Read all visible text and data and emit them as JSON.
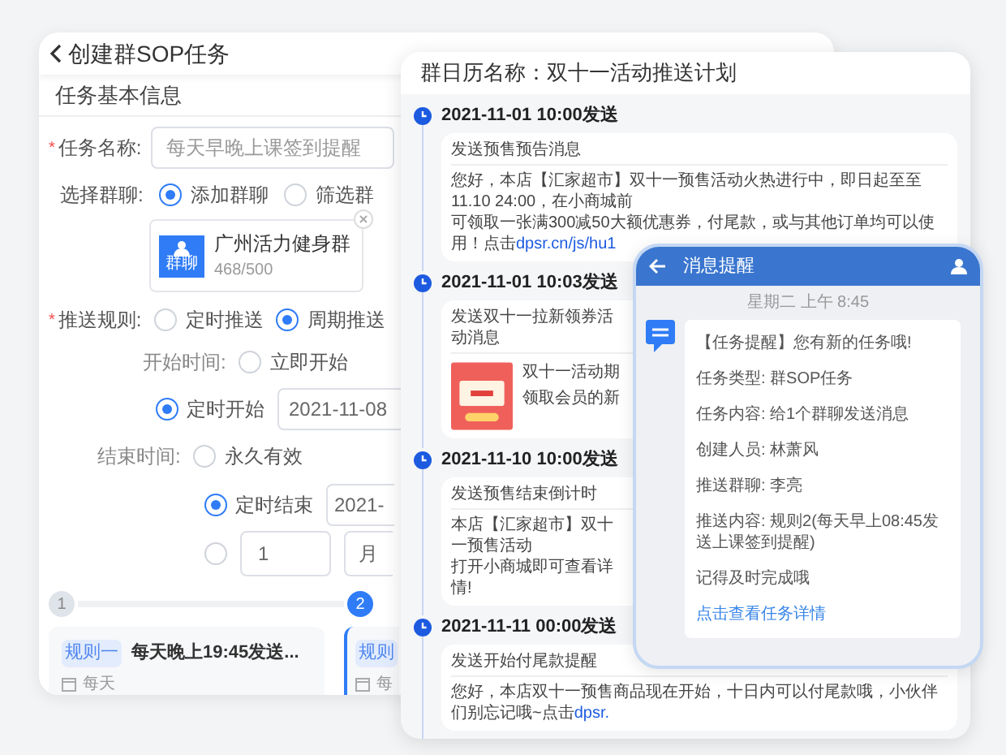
{
  "form_window": {
    "title": "创建群SOP任务",
    "section": "任务基本信息",
    "task_name": {
      "label": "任务名称:",
      "required_mark": "*",
      "value": "每天早晚上课签到提醒"
    },
    "group_select": {
      "label": "选择群聊:",
      "options": [
        {
          "label": "添加群聊",
          "selected": true
        },
        {
          "label": "筛选群",
          "selected": false
        }
      ]
    },
    "group_chip": {
      "icon_label": "群聊",
      "name": "广州活力健身群",
      "count": "468/500"
    },
    "push_rule": {
      "label": "推送规则:",
      "required_mark": "*",
      "options": [
        {
          "label": "定时推送",
          "selected": false
        },
        {
          "label": "周期推送",
          "selected": true
        }
      ]
    },
    "start_time": {
      "label": "开始时间:",
      "options": [
        {
          "kind": "text",
          "label": "立即开始",
          "selected": false
        },
        {
          "kind": "date",
          "label": "定时开始",
          "selected": true,
          "date": "2021-11-08"
        }
      ]
    },
    "end_time": {
      "label": "结束时间:",
      "options": [
        {
          "kind": "text",
          "label": "永久有效",
          "selected": false
        },
        {
          "kind": "date",
          "label": "定时结束",
          "selected": true,
          "date": "2021-"
        },
        {
          "kind": "count",
          "selected": false,
          "count": "1",
          "unit": "月"
        }
      ]
    },
    "steps": [
      {
        "number": "1",
        "selected": false
      },
      {
        "number": "2",
        "selected": true
      }
    ],
    "rules": [
      {
        "tag": "规则一",
        "title": "每天晚上19:45发送...",
        "frequency": "每天",
        "selected": false
      },
      {
        "tag": "规则",
        "frequency": "每",
        "selected": true
      }
    ]
  },
  "calendar_window": {
    "title": "群日历名称：双十一活动推送计划",
    "events": [
      {
        "time": "2021-11-01 10:00发送",
        "title": "发送预售预告消息",
        "kind": "text",
        "lines": [
          "您好，本店【汇家超市】双十一预售活动火热进行中，即日起至至11.10 24:00，在小商城前",
          "可领取一张满300减50大额优惠券，付尾款，或与其他订单均可以使用！点击"
        ],
        "link": "dpsr.cn/js/hu1"
      },
      {
        "time": "2021-11-01 10:03发送",
        "title": "发送双十一拉新领券活动消息",
        "kind": "image",
        "lines": [
          "双十一活动期",
          "领取会员的新"
        ]
      },
      {
        "time": "2021-11-10 10:00发送",
        "title": "发送预售结束倒计时",
        "kind": "text",
        "lines": [
          "本店【汇家超市】双十一预售活动",
          "打开小商城即可查看详情!"
        ]
      },
      {
        "time": "2021-11-11 00:00发送",
        "title": "发送开始付尾款提醒",
        "kind": "text",
        "lines": [
          "您好，本店双十一预售商品现在开始，十日内可以付尾款哦，小伙伴们别忘记哦~点击"
        ],
        "link": "dpsr."
      }
    ]
  },
  "message_window": {
    "title": "消息提醒",
    "time": "星期二 上午 8:45",
    "lines": [
      "【任务提醒】您有新的任务哦!",
      "任务类型: 群SOP任务",
      "任务内容: 给1个群聊发送消息",
      "创建人员: 林萧风",
      "推送群聊: 李亮",
      "推送内容: 规则2(每天早上08:45发送上课签到提醒)",
      "记得及时完成哦"
    ],
    "link": "点击查看任务详情"
  }
}
